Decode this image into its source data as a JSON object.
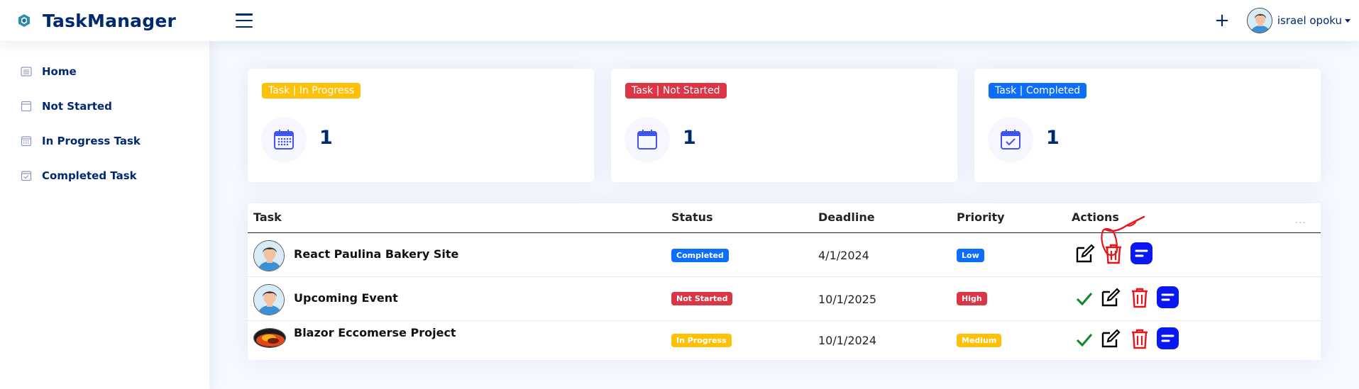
{
  "app": {
    "title": "TaskManager"
  },
  "header": {
    "add_label": "+",
    "user_name": "israel opoku"
  },
  "sidebar": {
    "items": [
      {
        "label": "Home",
        "icon": "list-alt-icon"
      },
      {
        "label": "Not Started",
        "icon": "window-icon"
      },
      {
        "label": "In Progress Task",
        "icon": "calendar-grid-icon"
      },
      {
        "label": "Completed Task",
        "icon": "calendar-check-icon"
      }
    ]
  },
  "cards": [
    {
      "badge": "Task | In Progress",
      "count": "1",
      "badge_color": "#ffc107",
      "icon": "calendar-dots-icon"
    },
    {
      "badge": "Task | Not Started",
      "count": "1",
      "badge_color": "#dc3545",
      "icon": "calendar-blank-icon"
    },
    {
      "badge": "Task | Completed",
      "count": "1",
      "badge_color": "#0d6efd",
      "icon": "calendar-check-icon"
    }
  ],
  "table": {
    "columns": [
      "Task",
      "Status",
      "Deadline",
      "Priority",
      "Actions"
    ],
    "more_label": "...",
    "rows": [
      {
        "task": "React Paulina Bakery Site",
        "status": "Completed",
        "status_color": "#0d6efd",
        "deadline": "4/1/2024",
        "priority": "Low",
        "priority_color": "#0d6efd"
      },
      {
        "task": "Upcoming Event",
        "status": "Not Started",
        "status_color": "#dc3545",
        "deadline": "10/1/2025",
        "priority": "High",
        "priority_color": "#dc3545"
      },
      {
        "task": "Blazor Eccomerse Project",
        "status": "In Progress",
        "status_color": "#ffc107",
        "deadline": "10/1/2024",
        "priority": "Medium",
        "priority_color": "#ffc107"
      }
    ]
  },
  "colors": {
    "primary": "#012970",
    "accent": "#4154f1",
    "background": "#f6f9ff"
  }
}
